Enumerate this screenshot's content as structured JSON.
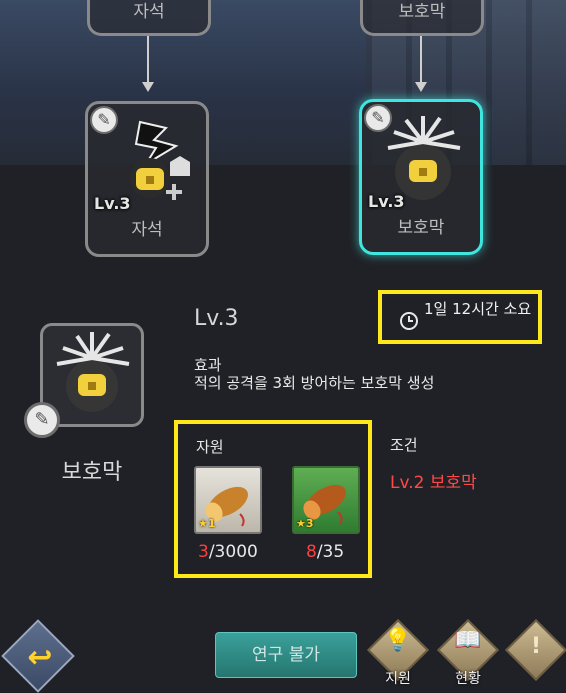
{
  "tree": {
    "top_left_stub": "자석",
    "top_right_stub": "보호막",
    "left_node": {
      "level": "Lv.3",
      "label": "자석"
    },
    "right_node": {
      "level": "Lv.3",
      "label": "보호막"
    }
  },
  "detail": {
    "name": "보호막",
    "level": "Lv.3",
    "time": "1일 12시간 소요",
    "effect_title": "효과",
    "effect_desc": "적의 공격을 3회 방어하는 보호막 생성",
    "resources_title": "자원",
    "resources": [
      {
        "stars": "1",
        "have": "3",
        "need": "/3000"
      },
      {
        "stars": "3",
        "have": "8",
        "need": "/35"
      }
    ],
    "condition_title": "조건",
    "condition_value": "Lv.2 보호막"
  },
  "bottom": {
    "research_button": "연구 불가",
    "support_label": "지원",
    "status_label": "현황"
  },
  "colors": {
    "highlight": "#ffe81a",
    "selected": "#3ee6df",
    "warning": "#ff4949"
  }
}
